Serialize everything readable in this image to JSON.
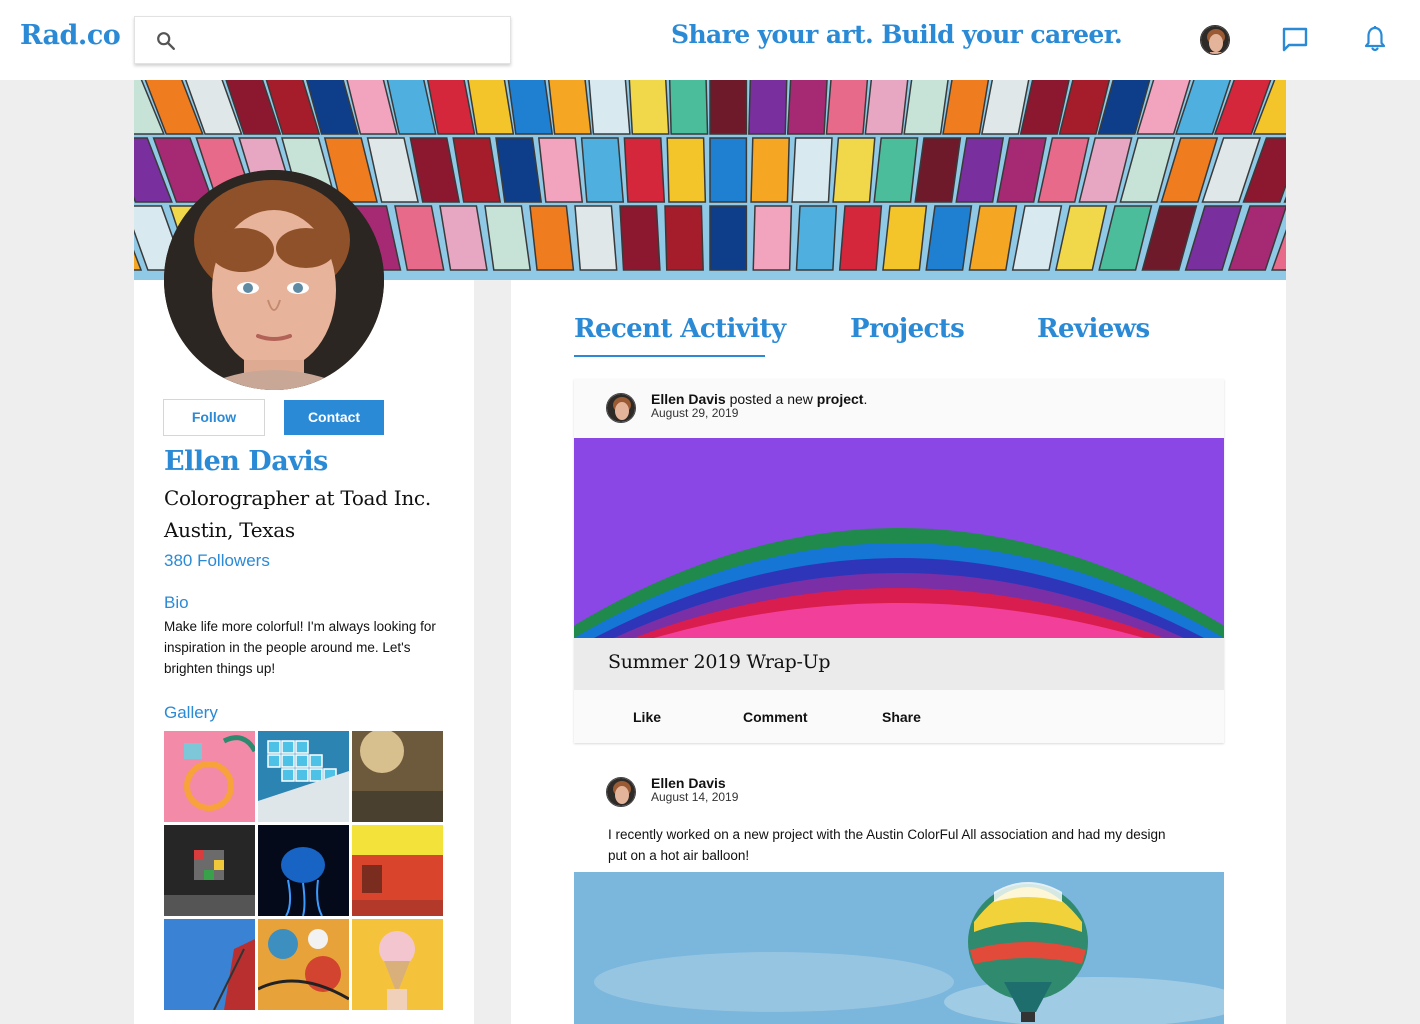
{
  "app": {
    "logo": "Rad.co",
    "tagline": "Share your art. Build your career."
  },
  "search": {
    "placeholder": "",
    "value": ""
  },
  "header_icons": [
    "avatar",
    "message-icon",
    "bell-icon"
  ],
  "profile": {
    "follow_label": "Follow",
    "contact_label": "Contact",
    "name": "Ellen Davis",
    "job": "Colorographer at Toad Inc.",
    "location": "Austin, Texas",
    "followers": "380 Followers",
    "bio_heading": "Bio",
    "bio": "Make life more colorful! I'm always looking for inspiration in the people around me. Let's brighten things up!",
    "gallery_heading": "Gallery"
  },
  "tabs": [
    {
      "label": "Recent Activity",
      "active": true
    },
    {
      "label": "Projects",
      "active": false
    },
    {
      "label": "Reviews",
      "active": false
    }
  ],
  "posts": [
    {
      "author": "Ellen Davis",
      "action_text": " posted a new ",
      "action_target": "project",
      "action_end": ".",
      "date": "August 29, 2019",
      "title": "Summer 2019 Wrap-Up",
      "actions": [
        "Like",
        "Comment",
        "Share"
      ]
    },
    {
      "author": "Ellen Davis",
      "date": "August 14, 2019",
      "text": "I recently worked on a new project with the Austin ColorFul All association and had my design put on a hot air balloon!"
    }
  ],
  "colors": {
    "accent": "#2a8ad6",
    "background": "#eeeeee"
  }
}
